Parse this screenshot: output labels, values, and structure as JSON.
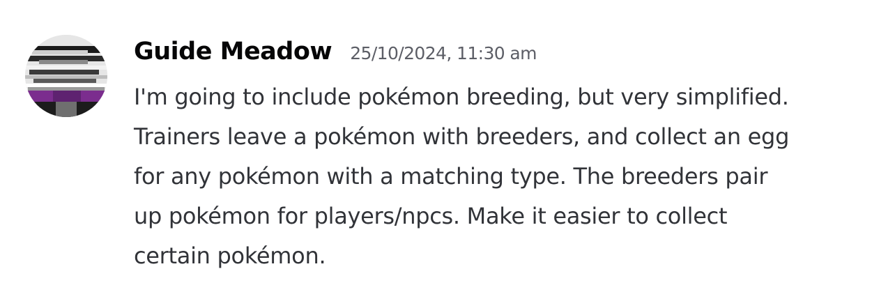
{
  "message": {
    "author": "Guide Meadow",
    "timestamp": "25/10/2024, 11:30 am",
    "lines": [
      "I'm going to include pokémon breeding, but very simplified.",
      "Trainers leave a pokémon with breeders, and collect an egg",
      "for any pokémon with a matching type. The breeders pair",
      "up pokémon for players/npcs. Make it easier to collect",
      "certain pokémon."
    ]
  },
  "colors": {
    "author": "#060607",
    "timestamp": "#5c5e66",
    "text": "#313338",
    "background": "#ffffff",
    "avatar_flag_purple": "#7b2d8e"
  }
}
